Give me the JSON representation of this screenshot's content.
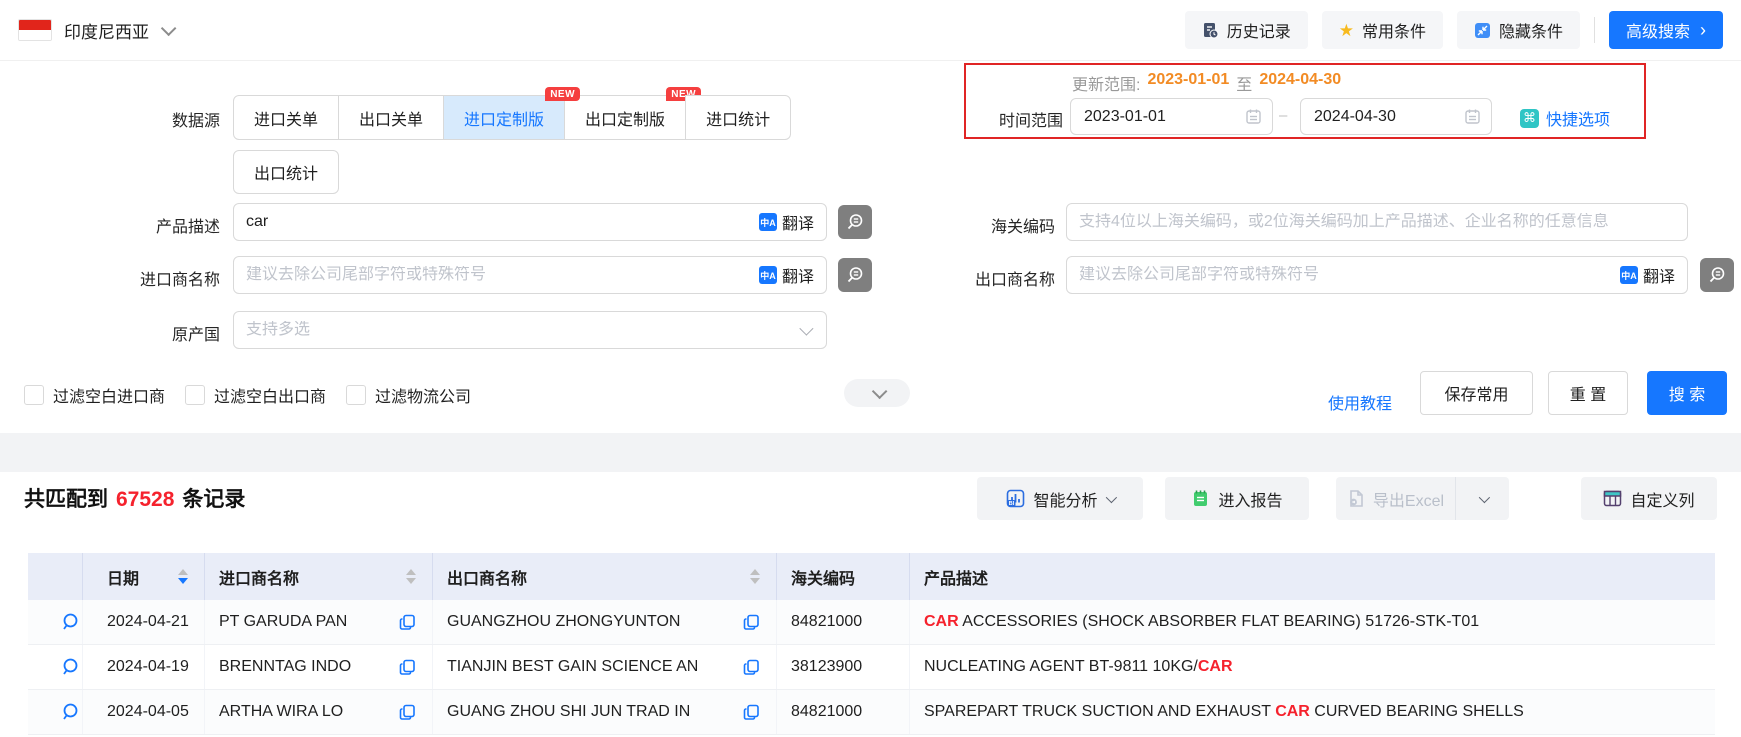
{
  "topbar": {
    "country": "印度尼西亚",
    "history_label": "历史记录",
    "favorites_label": "常用条件",
    "hide_label": "隐藏条件",
    "advanced_label": "高级搜索",
    "advanced_chevron": "›"
  },
  "filters": {
    "datasource_label": "数据源",
    "datasource_tabs": [
      {
        "label": "进口关单"
      },
      {
        "label": "出口关单"
      },
      {
        "label": "进口定制版",
        "badge": "NEW",
        "active": true
      },
      {
        "label": "出口定制版",
        "badge": "NEW"
      },
      {
        "label": "进口统计"
      },
      {
        "label": "出口统计"
      }
    ],
    "update_range": {
      "label": "更新范围:",
      "from": "2023-01-01",
      "joiner": "至",
      "to": "2024-04-30"
    },
    "time_range": {
      "label": "时间范围",
      "from": "2023-01-01",
      "to": "2024-04-30",
      "dash": "–",
      "quick_label": "快捷选项",
      "quick_icon": "⌘"
    },
    "product_desc": {
      "label": "产品描述",
      "value": "car",
      "translate": "翻译",
      "translate_icon": "中A"
    },
    "hs_code": {
      "label": "海关编码",
      "placeholder": "支持4位以上海关编码，或2位海关编码加上产品描述、企业名称的任意信息"
    },
    "importer": {
      "label": "进口商名称",
      "placeholder": "建议去除公司尾部字符或特殊符号",
      "translate": "翻译",
      "translate_icon": "中A"
    },
    "exporter": {
      "label": "出口商名称",
      "placeholder": "建议去除公司尾部字符或特殊符号",
      "translate": "翻译",
      "translate_icon": "中A"
    },
    "origin": {
      "label": "原产国",
      "placeholder": "支持多选"
    },
    "checkboxes": [
      {
        "label": "过滤空白进口商",
        "checked": false
      },
      {
        "label": "过滤空白出口商",
        "checked": false
      },
      {
        "label": "过滤物流公司",
        "checked": false
      }
    ],
    "tutorial_label": "使用教程",
    "save_label": "保存常用",
    "reset_label": "重 置",
    "search_label": "搜 索"
  },
  "results": {
    "summary_prefix": "共匹配到",
    "count": "67528",
    "summary_suffix": "条记录",
    "analysis_label": "智能分析",
    "report_label": "进入报告",
    "export_label": "导出Excel",
    "columns_label": "自定义列"
  },
  "table": {
    "headers": {
      "date": "日期",
      "importer": "进口商名称",
      "exporter": "出口商名称",
      "hs_code": "海关编码",
      "product": "产品描述"
    },
    "sort": {
      "date": "desc"
    },
    "rows": [
      {
        "date": "2024-04-21",
        "importer": "PT GARUDA PAN",
        "exporter": "GUANGZHOU ZHONGYUNTON",
        "hs": "84821000",
        "desc_parts": [
          {
            "text": "CAR",
            "hl": true
          },
          {
            "text": " ACCESSORIES (SHOCK ABSORBER FLAT BEARING) 51726-STK-T01",
            "hl": false
          }
        ]
      },
      {
        "date": "2024-04-19",
        "importer": "BRENNTAG INDO",
        "exporter": "TIANJIN BEST GAIN SCIENCE AN",
        "hs": "38123900",
        "desc_parts": [
          {
            "text": "NUCLEATING AGENT BT-9811 10KG/",
            "hl": false
          },
          {
            "text": "CAR",
            "hl": true
          }
        ]
      },
      {
        "date": "2024-04-05",
        "importer": "ARTHA WIRA LO",
        "exporter": "GUANG ZHOU SHI JUN TRAD IN",
        "hs": "84821000",
        "desc_parts": [
          {
            "text": "SPAREPART TRUCK SUCTION AND EXHAUST ",
            "hl": false
          },
          {
            "text": "CAR",
            "hl": true
          },
          {
            "text": " CURVED BEARING SHELLS",
            "hl": false
          }
        ]
      }
    ]
  },
  "colors": {
    "accent": "#1677ff",
    "danger_red": "#f5222d",
    "badge_red": "#f53f3f",
    "panel_red": "#e02525",
    "orange_date": "#f28b24",
    "teal": "#2fc5c5",
    "green": "#41cc6e",
    "table_header_bg": "#e9edf8",
    "active_tab_bg": "#d7eafc"
  }
}
